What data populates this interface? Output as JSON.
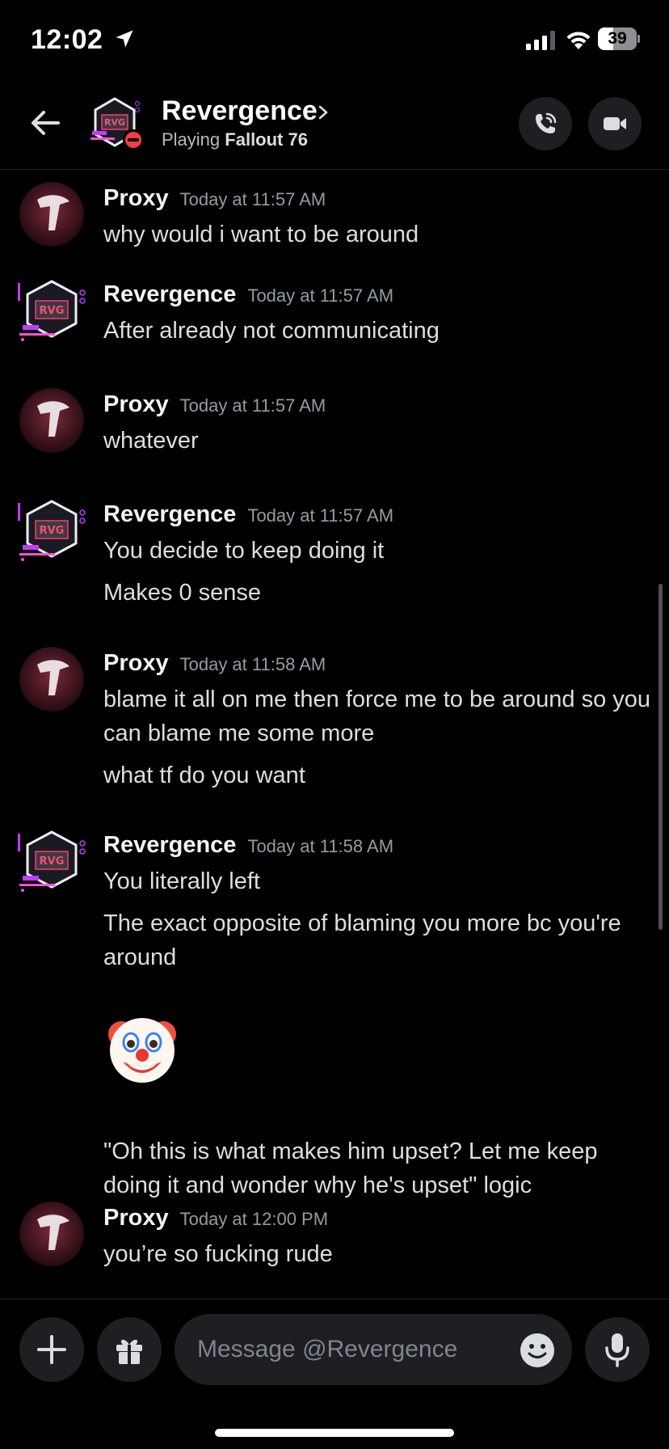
{
  "status_bar": {
    "time": "12:02",
    "battery": "39",
    "battery_level": 0.39
  },
  "header": {
    "name": "Revergence",
    "status_prefix": "Playing",
    "status_game": "Fallout 76"
  },
  "messages": [
    {
      "author": "Proxy",
      "time": "Today at 11:57 AM",
      "lines": [
        "why would i want to be around"
      ]
    },
    {
      "author": "Revergence",
      "time": "Today at 11:57 AM",
      "lines": [
        "After already not communicating"
      ]
    },
    {
      "author": "Proxy",
      "time": "Today at 11:57 AM",
      "lines": [
        "whatever"
      ]
    },
    {
      "author": "Revergence",
      "time": "Today at 11:57 AM",
      "lines": [
        "You decide to keep doing it",
        "Makes 0 sense"
      ]
    },
    {
      "author": "Proxy",
      "time": "Today at 11:58 AM",
      "lines": [
        "blame it all on me then force me to be around so you can blame me some more",
        "what tf do you want"
      ]
    },
    {
      "author": "Revergence",
      "time": "Today at 11:58 AM",
      "lines": [
        "You literally left",
        "The exact opposite of blaming you more bc you're around",
        "\"Oh this is what makes him upset? Let me keep doing it and wonder why he's upset\" logic"
      ],
      "emoji": "clown-face"
    },
    {
      "author": "Proxy",
      "time": "Today at 12:00 PM",
      "lines": [
        "you’re so fucking rude"
      ]
    }
  ],
  "composer": {
    "placeholder": "Message @Revergence",
    "value": ""
  },
  "icons": {
    "back": "arrow-left-icon",
    "call": "phone-call-icon",
    "video": "video-camera-icon",
    "plus": "plus-icon",
    "gift": "gift-icon",
    "emoji": "smile-icon",
    "mic": "microphone-icon"
  },
  "colors": {
    "background": "#000000",
    "surface": "#1e1f22",
    "dnd": "#f23f43",
    "muted": "#949ba4",
    "text": "#dbdee1"
  }
}
